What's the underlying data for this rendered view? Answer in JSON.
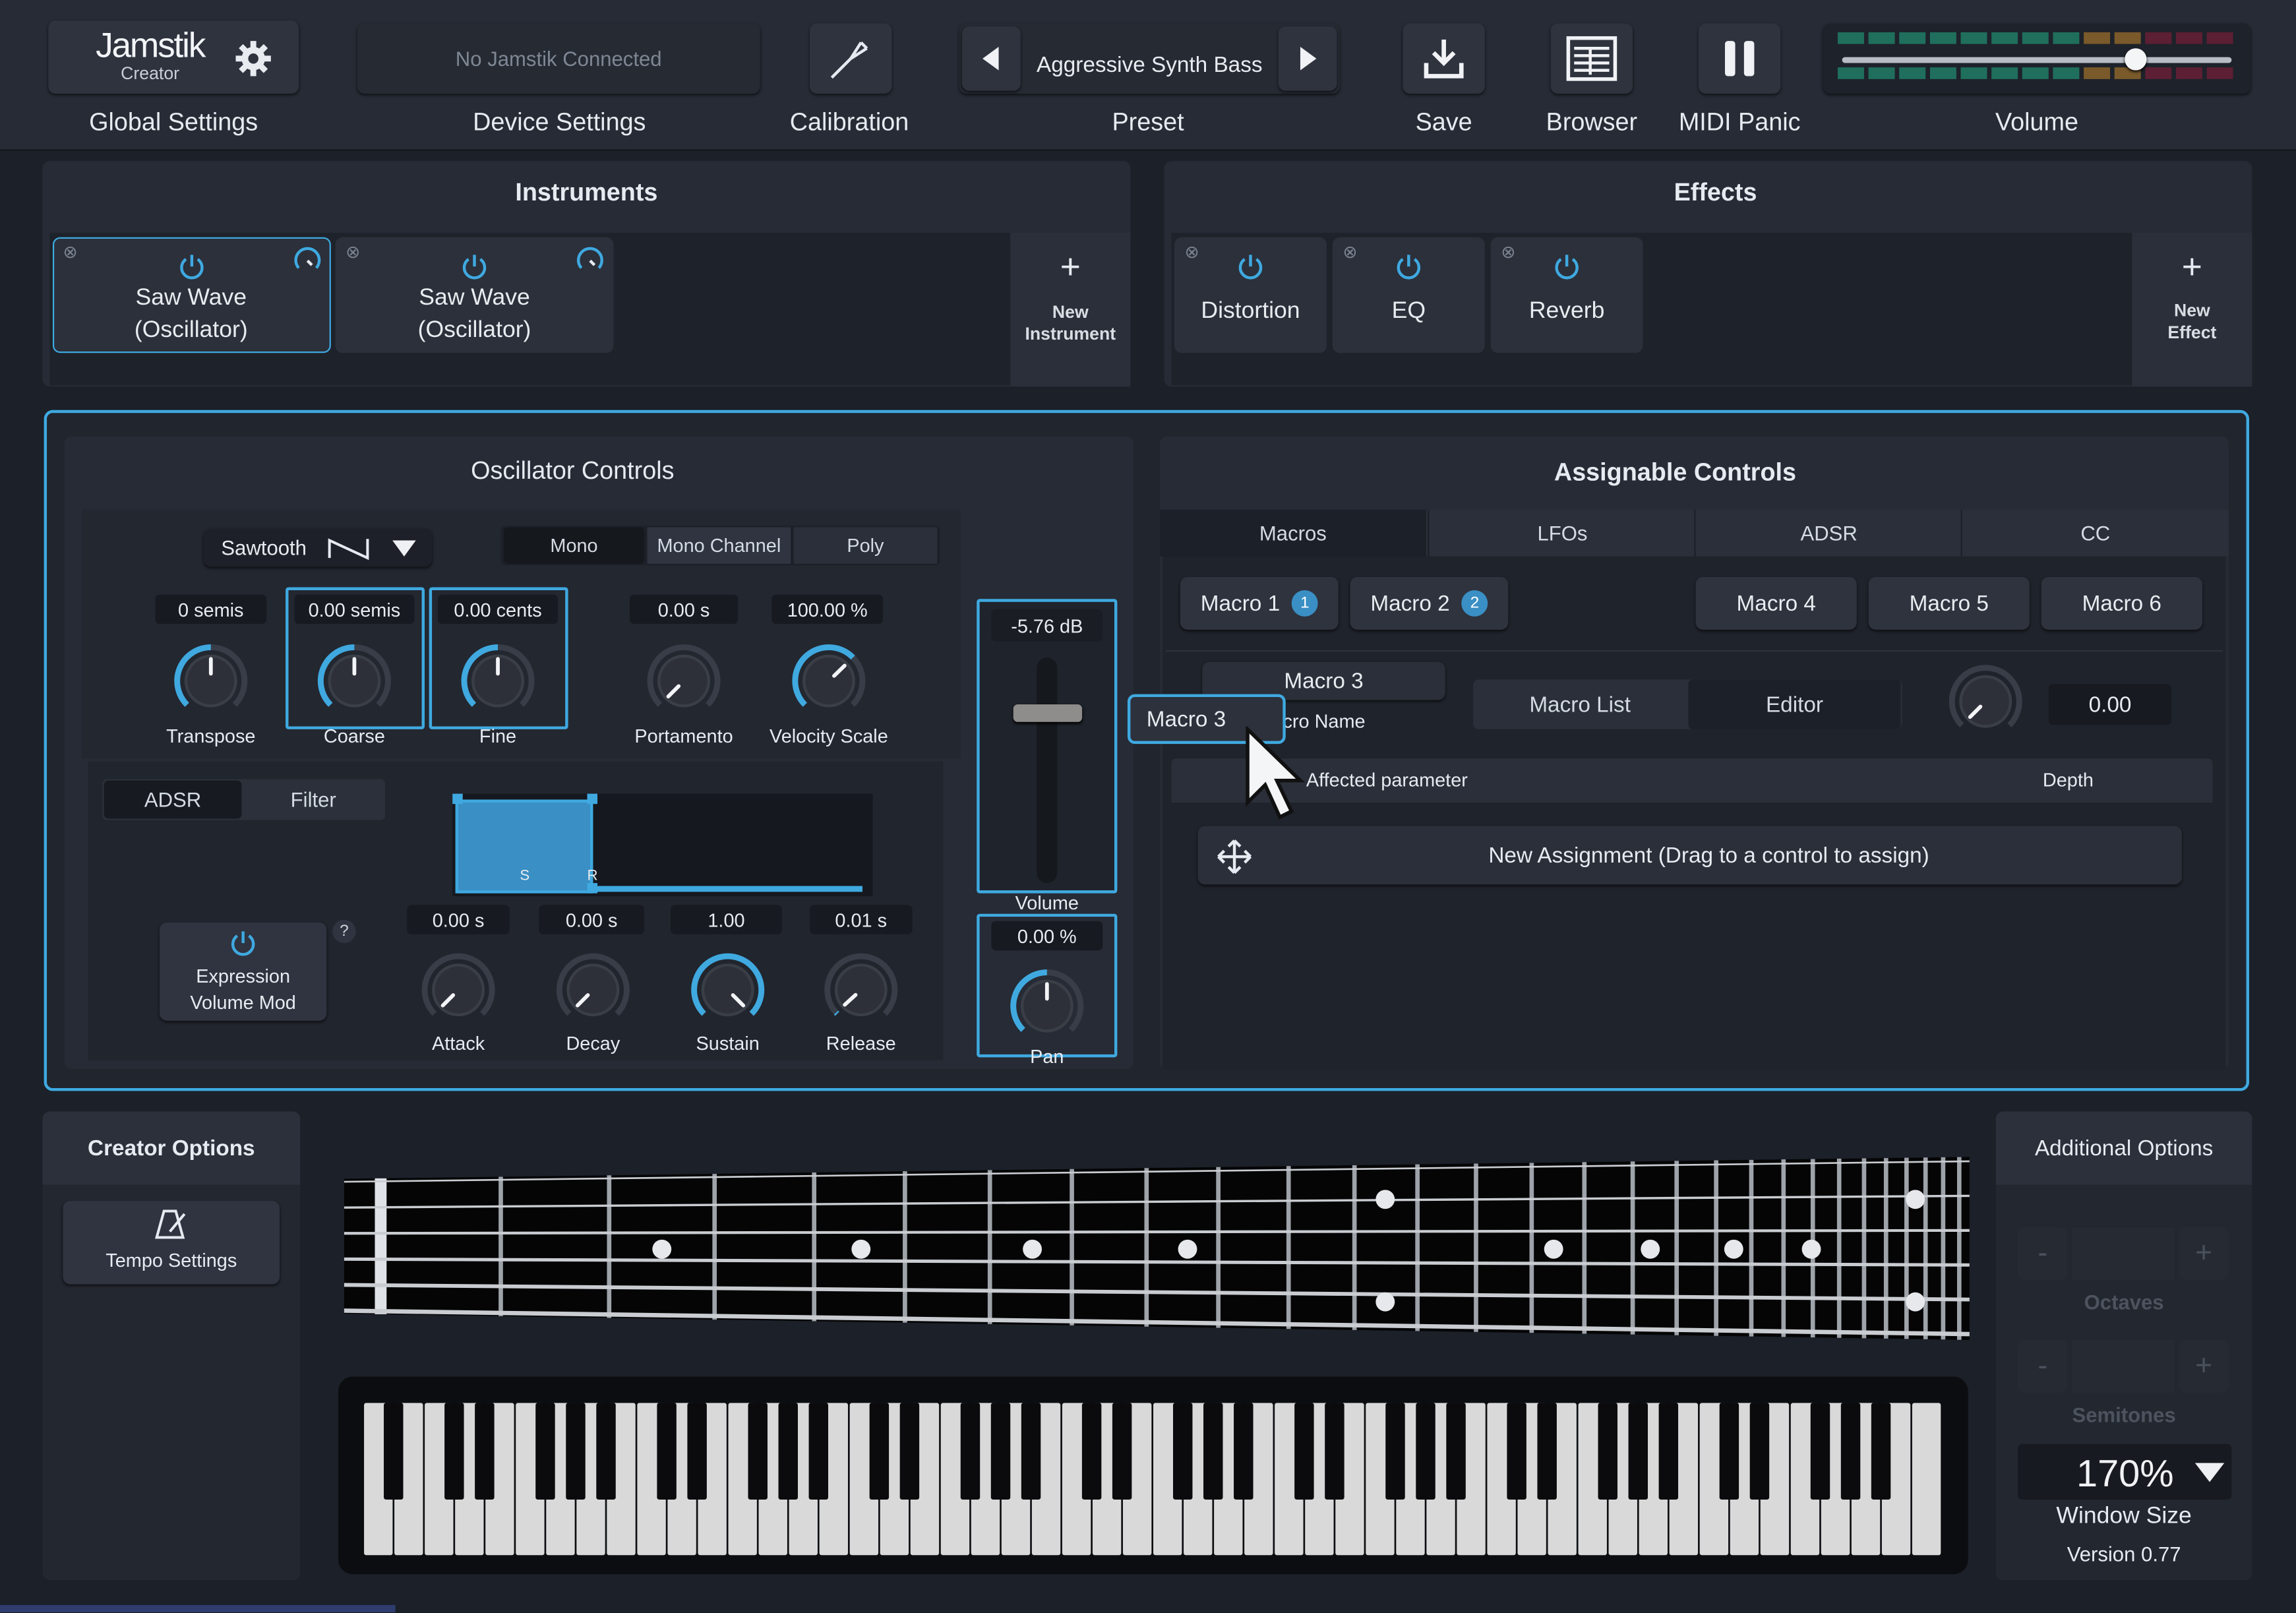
{
  "topbar": {
    "logo": "Jamstik",
    "logo_sub": "Creator",
    "global_settings": "Global Settings",
    "device_status": "No Jamstik Connected",
    "device_settings": "Device Settings",
    "calibration": "Calibration",
    "preset_name": "Aggressive Synth Bass",
    "preset": "Preset",
    "save": "Save",
    "browser": "Browser",
    "midi_panic": "MIDI Panic",
    "volume": "Volume"
  },
  "instruments": {
    "title": "Instruments",
    "items": [
      {
        "line1": "Saw Wave",
        "line2": "(Oscillator)"
      },
      {
        "line1": "Saw Wave",
        "line2": "(Oscillator)"
      }
    ],
    "new_line1": "New",
    "new_line2": "Instrument"
  },
  "effects": {
    "title": "Effects",
    "items": [
      "Distortion",
      "EQ",
      "Reverb"
    ],
    "new_line1": "New",
    "new_line2": "Effect"
  },
  "oscillator": {
    "title": "Oscillator Controls",
    "waveform": "Sawtooth",
    "voice_modes": [
      "Mono",
      "Mono Channel",
      "Poly"
    ],
    "knobs": [
      {
        "value": "0 semis",
        "label": "Transpose"
      },
      {
        "value": "0.00 semis",
        "label": "Coarse"
      },
      {
        "value": "0.00 cents",
        "label": "Fine"
      },
      {
        "value": "0.00 s",
        "label": "Portamento"
      },
      {
        "value": "100.00 %",
        "label": "Velocity Scale"
      }
    ],
    "env_tabs": [
      "ADSR",
      "Filter"
    ],
    "env_marks": [
      "S",
      "R"
    ],
    "expression_line1": "Expression",
    "expression_line2": "Volume Mod",
    "help": "?",
    "adsr": [
      {
        "value": "0.00 s",
        "label": "Attack"
      },
      {
        "value": "0.00 s",
        "label": "Decay"
      },
      {
        "value": "1.00",
        "label": "Sustain"
      },
      {
        "value": "0.01 s",
        "label": "Release"
      }
    ],
    "volume_value": "-5.76 dB",
    "volume_label": "Volume",
    "pan_value": "0.00 %",
    "pan_label": "Pan"
  },
  "assignable": {
    "title": "Assignable Controls",
    "tabs": [
      "Macros",
      "LFOs",
      "ADSR",
      "CC"
    ],
    "macros": [
      {
        "label": "Macro 1",
        "badge": "1"
      },
      {
        "label": "Macro 2",
        "badge": "2"
      },
      {
        "label": "Macro 4"
      },
      {
        "label": "Macro 5"
      },
      {
        "label": "Macro 6"
      }
    ],
    "macro_name": "Macro 3",
    "macro_name_caption": "Macro Name",
    "drag_tooltip": "Macro 3",
    "view_tabs": [
      "Macro List",
      "Editor"
    ],
    "macro_value": "0.00",
    "col_param": "Affected parameter",
    "col_depth": "Depth",
    "new_assignment": "New Assignment (Drag to a control to assign)"
  },
  "creator": {
    "title": "Creator Options",
    "tempo": "Tempo Settings"
  },
  "additional": {
    "title": "Additional Options",
    "minus": "-",
    "plus": "+",
    "octaves": "Octaves",
    "semitones": "Semitones",
    "zoom": "170%",
    "window_size": "Window Size",
    "version": "Version 0.77"
  },
  "colors": {
    "accent": "#3fa9e0",
    "panel": "#262b35",
    "background": "#1b2029",
    "meter_green": "#1f6f5c",
    "meter_orange": "#7a5a2a",
    "meter_red": "#5c1f33"
  },
  "meter": {
    "volume_level": 0.75
  }
}
